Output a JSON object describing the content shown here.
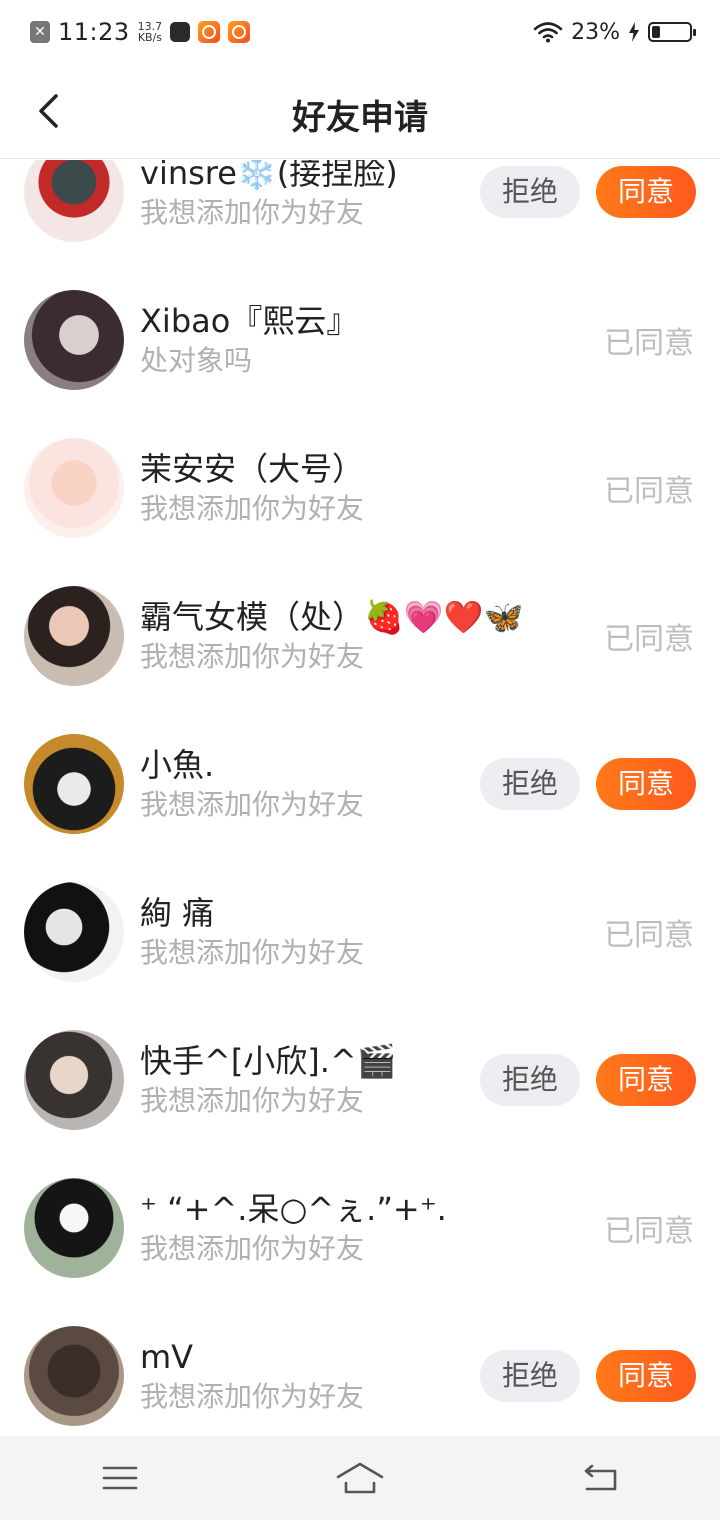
{
  "status_bar": {
    "time": "11:23",
    "net_speed_value": "13.7",
    "net_speed_unit": "KB/s",
    "battery_percent": "23%",
    "battery_level": 0.23,
    "icons": [
      "close-notification-icon",
      "app-square-icon",
      "kuaishou-app-icon",
      "kuaishou-app-icon",
      "wifi-icon",
      "charging-icon",
      "battery-icon"
    ]
  },
  "header": {
    "title": "好友申请",
    "back_icon": "chevron-left-icon"
  },
  "requests": [
    {
      "name": "vinsre❄️(接捏脸)",
      "message": "我想添加你为好友",
      "status": "pending"
    },
    {
      "name": "Xibao『熙云』",
      "message": "处对象吗",
      "status": "accepted"
    },
    {
      "name": "茉安安（大号）",
      "message": "我想添加你为好友",
      "status": "accepted"
    },
    {
      "name": "霸气女模（处）🍓💗❤️🦋",
      "message": "我想添加你为好友",
      "status": "accepted"
    },
    {
      "name": "小魚.",
      "message": "我想添加你为好友",
      "status": "pending"
    },
    {
      "name": "絢 痛",
      "message": "我想添加你为好友",
      "status": "accepted"
    },
    {
      "name": "快手^[小欣].^🎬",
      "message": "我想添加你为好友",
      "status": "pending"
    },
    {
      "name": "⁺ “+^.呆○^ぇ.”+⁺.",
      "message": "我想添加你为好友",
      "status": "accepted"
    },
    {
      "name": "mV",
      "message": "我想添加你为好友",
      "status": "pending"
    }
  ],
  "labels": {
    "reject": "拒绝",
    "accept": "同意",
    "accepted": "已同意"
  },
  "colors": {
    "accent": "#fe5a1d",
    "reject_bg": "#ececf1",
    "muted_text": "#b0b0b0"
  },
  "nav_bar": {
    "icons": [
      "menu-icon",
      "home-icon",
      "back-icon"
    ]
  }
}
